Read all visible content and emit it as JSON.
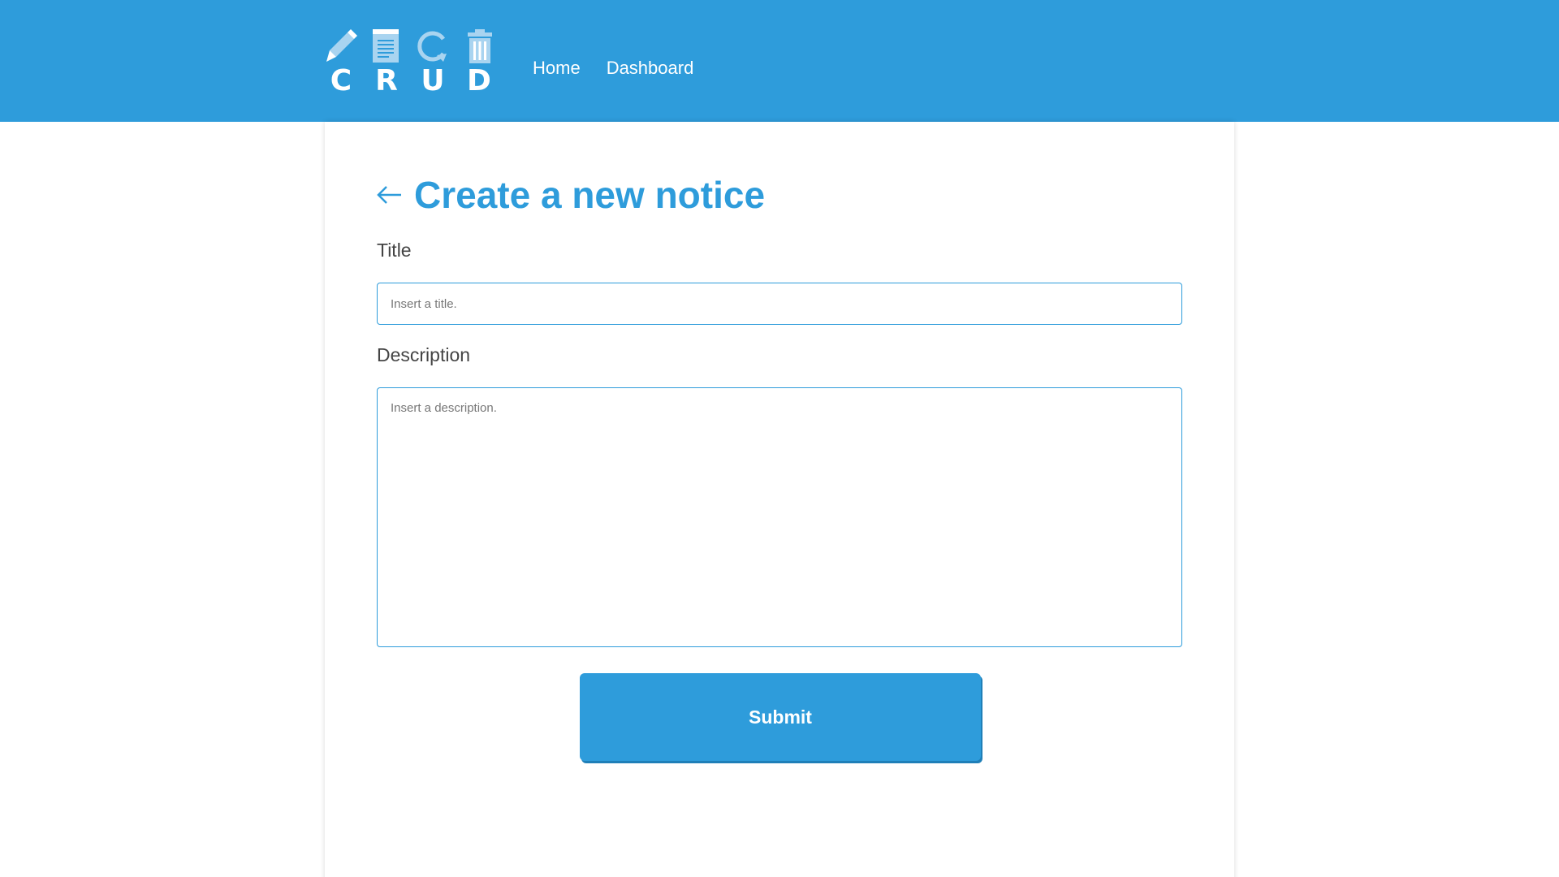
{
  "brand": {
    "letters": [
      "C",
      "R",
      "U",
      "D"
    ],
    "icons": [
      "pencil-icon",
      "document-icon",
      "refresh-icon",
      "trash-icon"
    ]
  },
  "nav": {
    "home_label": "Home",
    "dashboard_label": "Dashboard"
  },
  "form": {
    "heading": "Create a new notice",
    "title_label": "Title",
    "title_placeholder": "Insert a title.",
    "title_value": "",
    "description_label": "Description",
    "description_placeholder": "Insert a description.",
    "description_value": "",
    "submit_label": "Submit"
  },
  "colors": {
    "accent": "#2e9cdb",
    "icon_tint": "#a9d4f0",
    "text": "#444444"
  },
  "icons": {
    "back": "arrow-left-icon"
  }
}
